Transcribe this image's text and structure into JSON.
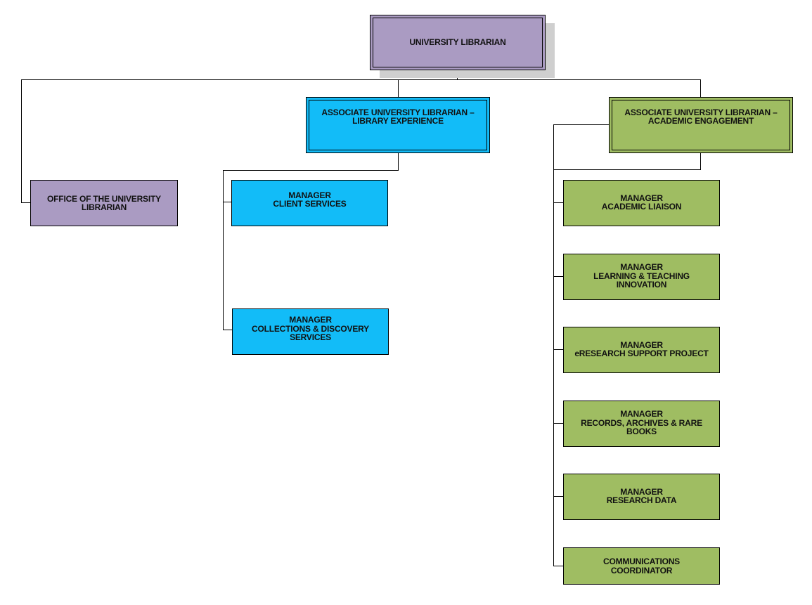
{
  "colors": {
    "executive": "#aa9bc2",
    "library_experience": "#12bcf8",
    "academic_engagement": "#9fbd62",
    "shadow": "#cfcfcf",
    "connector": "#000000"
  },
  "org_chart": {
    "root": {
      "title": "UNIVERSITY LIBRARIAN"
    },
    "office": {
      "title": "OFFICE OF THE UNIVERSITY\nLIBRARIAN"
    },
    "library_experience": {
      "title": "ASSOCIATE UNIVERSITY LIBRARIAN –\nLIBRARY EXPERIENCE",
      "reports": [
        {
          "title": "MANAGER\nCLIENT SERVICES"
        },
        {
          "title": "MANAGER\nCOLLECTIONS & DISCOVERY\nSERVICES"
        }
      ]
    },
    "academic_engagement": {
      "title": "ASSOCIATE UNIVERSITY LIBRARIAN –\nACADEMIC ENGAGEMENT",
      "reports": [
        {
          "title": "MANAGER\nACADEMIC LIAISON"
        },
        {
          "title": "MANAGER\nLEARNING & TEACHING\nINNOVATION"
        },
        {
          "title": "MANAGER\neRESEARCH SUPPORT PROJECT"
        },
        {
          "title": "MANAGER\nRECORDS, ARCHIVES & RARE\nBOOKS"
        },
        {
          "title": "MANAGER\nRESEARCH DATA"
        },
        {
          "title": "COMMUNICATIONS\nCOORDINATOR"
        }
      ]
    }
  }
}
